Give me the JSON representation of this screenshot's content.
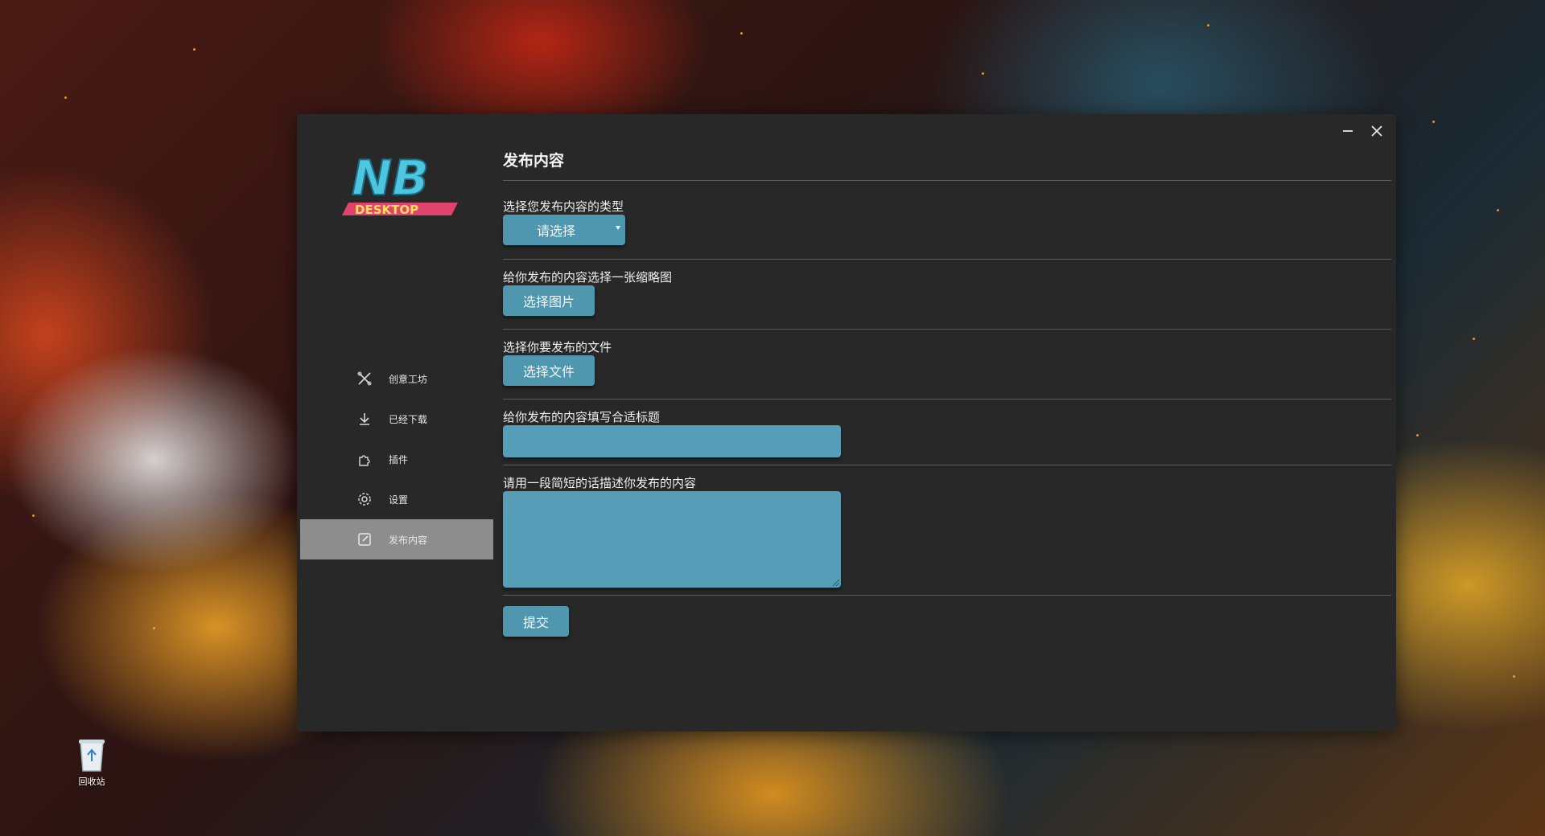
{
  "window": {
    "minimize_icon": "minimize-icon",
    "close_icon": "close-icon"
  },
  "logo": {
    "top_text": "NB",
    "bottom_text": "DESKTOP"
  },
  "sidebar": {
    "items": [
      {
        "label": "创意工坊",
        "icon": "tools-icon",
        "active": false
      },
      {
        "label": "已经下载",
        "icon": "download-icon",
        "active": false
      },
      {
        "label": "插件",
        "icon": "puzzle-icon",
        "active": false
      },
      {
        "label": "设置",
        "icon": "gear-icon",
        "active": false
      },
      {
        "label": "发布内容",
        "icon": "edit-icon",
        "active": true
      }
    ]
  },
  "main": {
    "title": "发布内容",
    "type_label": "选择您发布内容的类型",
    "type_select_value": "请选择",
    "thumb_label": "给你发布的内容选择一张缩略图",
    "thumb_button": "选择图片",
    "file_label": "选择你要发布的文件",
    "file_button": "选择文件",
    "title_label": "给你发布的内容填写合适标题",
    "title_value": "",
    "desc_label": "请用一段简短的话描述你发布的内容",
    "desc_value": "",
    "submit_button": "提交"
  },
  "desktop": {
    "recycle_bin_label": "回收站"
  },
  "colors": {
    "window_bg": "#282828",
    "accent": "#4f97ae",
    "active_nav": "#8d8d8d"
  }
}
